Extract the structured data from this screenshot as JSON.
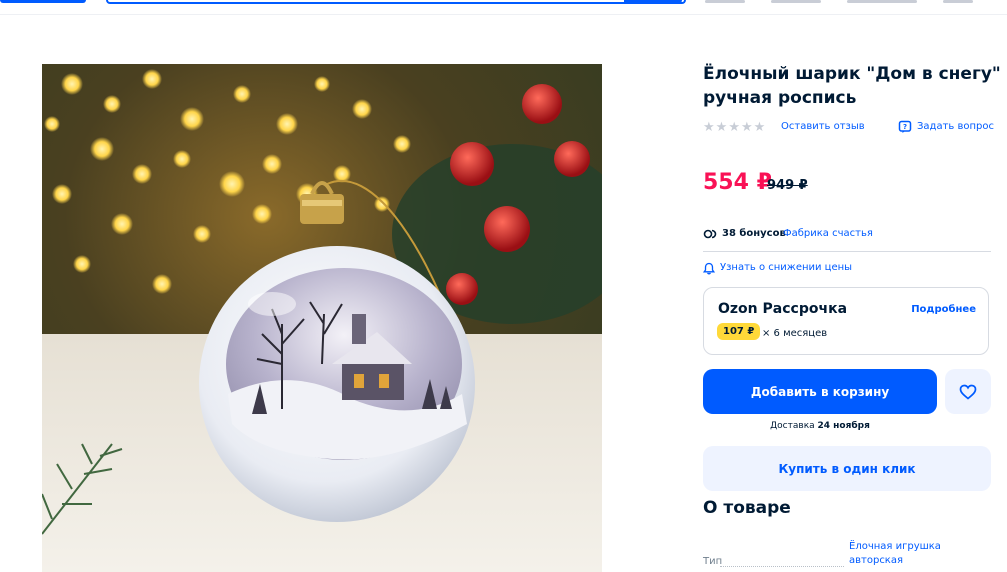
{
  "product": {
    "title": "Ёлочный шарик \"Дом в снегу\" ручная роспись",
    "rating_stars": 0,
    "review_link": "Оставить отзыв",
    "ask_link": "Задать вопрос",
    "price": "554 ₽",
    "old_price": "949 ₽",
    "bonus_text": "38 бонусов",
    "seller_link": "Фабрика счастья",
    "price_alert": "Узнать о снижении цены"
  },
  "installment": {
    "title": "Ozon Рассрочка",
    "more_link": "Подробнее",
    "monthly": "107 ₽",
    "months": "× 6 месяцев"
  },
  "actions": {
    "add_to_cart": "Добавить в корзину",
    "delivery_prefix": "Доставка",
    "delivery_date": "24 ноября",
    "buy_one_click": "Купить в один клик"
  },
  "about": {
    "heading": "О товаре",
    "spec_key": "Тип",
    "spec_value": "Ёлочная игрушка авторская"
  },
  "colors": {
    "accent": "#005bff",
    "price": "#f91155",
    "badge": "#ffd939",
    "secondary_bg": "#eef3ff"
  },
  "icons": [
    "star-icon",
    "question-icon",
    "bonus-icon",
    "bell-icon",
    "heart-icon"
  ]
}
